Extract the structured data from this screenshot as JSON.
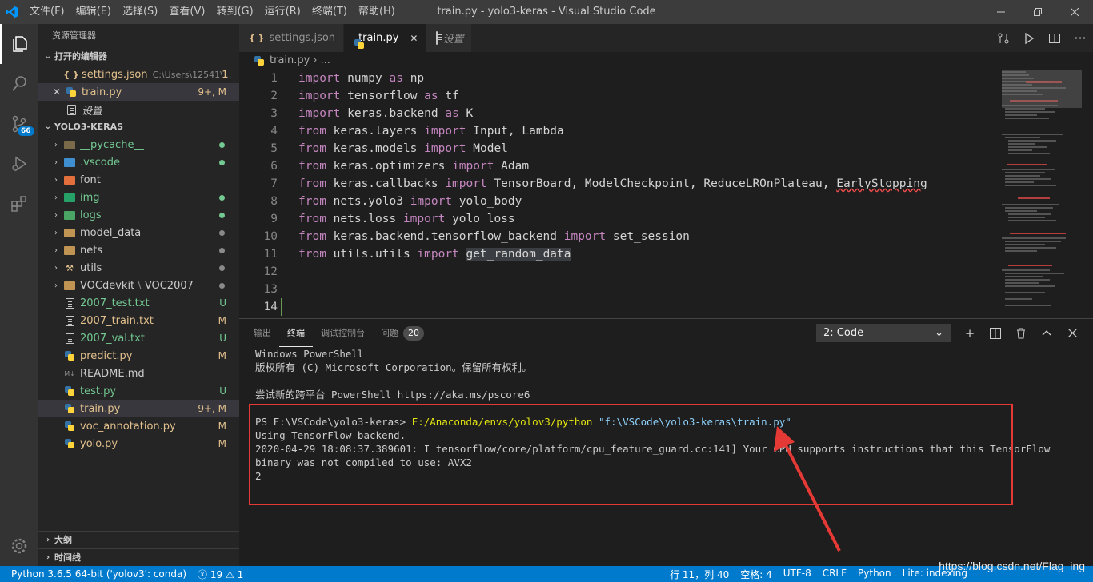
{
  "titlebar": {
    "menu": [
      "文件(F)",
      "编辑(E)",
      "选择(S)",
      "查看(V)",
      "转到(G)",
      "运行(R)",
      "终端(T)",
      "帮助(H)"
    ],
    "title": "train.py - yolo3-keras - Visual Studio Code"
  },
  "activity": {
    "scm_badge": "66"
  },
  "sidebar": {
    "header": "资源管理器",
    "open_editors": {
      "title": "打开的编辑器",
      "items": [
        {
          "name": "settings.json",
          "detail": "C:\\Users\\12541\\...",
          "status": "1"
        },
        {
          "name": "train.py",
          "detail": "",
          "status": "9+, M"
        },
        {
          "name": "设置",
          "detail": "",
          "status": ""
        }
      ]
    },
    "workspace": {
      "title": "YOLO3-KERAS",
      "folders": [
        "__pycache__",
        ".vscode",
        "font",
        "img",
        "logs",
        "model_data",
        "nets",
        "utils"
      ],
      "voc_folder": "VOCdevkit",
      "voc_sub": "VOC2007",
      "files": [
        {
          "name": "2007_test.txt",
          "status": "U"
        },
        {
          "name": "2007_train.txt",
          "status": "M"
        },
        {
          "name": "2007_val.txt",
          "status": "U"
        },
        {
          "name": "predict.py",
          "status": "M"
        },
        {
          "name": "README.md",
          "status": ""
        },
        {
          "name": "test.py",
          "status": "U"
        },
        {
          "name": "train.py",
          "status": "9+, M"
        },
        {
          "name": "voc_annotation.py",
          "status": "M"
        },
        {
          "name": "yolo.py",
          "status": "M"
        }
      ]
    },
    "outline": "大纲",
    "timeline": "时间线"
  },
  "editor": {
    "tabs": [
      "settings.json",
      "train.py",
      "设置"
    ],
    "breadcrumb": [
      "train.py",
      "..."
    ],
    "lines": [
      {
        "n": "1",
        "kw1": "import",
        "a": " numpy ",
        "kw2": "as",
        "b": " np"
      },
      {
        "n": "2",
        "kw1": "import",
        "a": " tensorflow ",
        "kw2": "as",
        "b": " tf"
      },
      {
        "n": "3",
        "kw1": "import",
        "a": " keras.backend ",
        "kw2": "as",
        "b": " K"
      },
      {
        "n": "4",
        "kw1": "from",
        "a": " keras.layers ",
        "kw2": "import",
        "b": " Input, Lambda"
      },
      {
        "n": "5",
        "kw1": "from",
        "a": " keras.models ",
        "kw2": "import",
        "b": " Model"
      },
      {
        "n": "6",
        "kw1": "from",
        "a": " keras.optimizers ",
        "kw2": "import",
        "b": " Adam"
      },
      {
        "n": "7",
        "kw1": "from",
        "a": " keras.callbacks ",
        "kw2": "import",
        "b": " TensorBoard, ModelCheckpoint, ReduceLROnPlateau, ",
        "sq": "EarlyStopping"
      },
      {
        "n": "8",
        "kw1": "from",
        "a": " nets.yolo3 ",
        "kw2": "import",
        "b": " yolo_body"
      },
      {
        "n": "9",
        "kw1": "from",
        "a": " nets.loss ",
        "kw2": "import",
        "b": " yolo_loss"
      },
      {
        "n": "10",
        "kw1": "from",
        "a": " keras.backend.tensorflow_backend ",
        "kw2": "import",
        "b": " set_session"
      },
      {
        "n": "11",
        "kw1": "from",
        "a": " utils.utils ",
        "kw2": "import",
        "b": " ",
        "hl": "get_random_data"
      },
      {
        "n": "12"
      },
      {
        "n": "13"
      },
      {
        "n": "14"
      }
    ]
  },
  "panel": {
    "tabs": [
      "输出",
      "终端",
      "调试控制台",
      "问题"
    ],
    "problems_count": "20",
    "terminal_select": "2: Code",
    "terminal": {
      "l1": "Windows PowerShell",
      "l2": "版权所有 (C) Microsoft Corporation。保留所有权利。",
      "l3": "尝试新的跨平台 PowerShell https://aka.ms/pscore6",
      "prompt": "PS F:\\VSCode\\yolo3-keras> ",
      "exe": "F:/Anaconda/envs/yolov3/python",
      "arg": " \"f:\\VSCode\\yolo3-keras\\train.py\"",
      "o1": "Using TensorFlow backend.",
      "o2": "2020-04-29 18:08:37.389601: I tensorflow/core/platform/cpu_feature_guard.cc:141] Your CPU supports instructions that this TensorFlow",
      "o3": "binary was not compiled to use: AVX2",
      "o4": "2"
    }
  },
  "status": {
    "interpreter": "Python 3.6.5 64-bit ('yolov3': conda)",
    "errors": "19",
    "warnings": "1",
    "position": "行 11，列 40",
    "spaces": "空格: 4",
    "encoding": "UTF-8",
    "eol": "CRLF",
    "language": "Python",
    "indexing": "Lite: indexing"
  },
  "watermark": "https://blog.csdn.net/Flag_ing"
}
